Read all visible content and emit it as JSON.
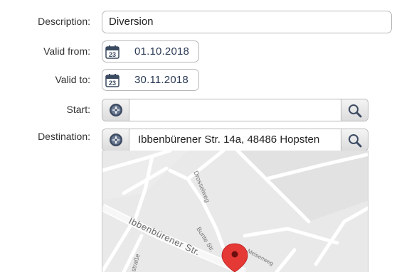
{
  "form": {
    "description": {
      "label": "Description:",
      "value": "Diversion"
    },
    "valid_from": {
      "label": "Valid from:",
      "value": "01.10.2018",
      "calendar_day": "23"
    },
    "valid_to": {
      "label": "Valid to:",
      "value": "30.11.2018",
      "calendar_day": "23"
    },
    "start": {
      "label": "Start:",
      "value": ""
    },
    "destination": {
      "label": "Destination:",
      "value": "Ibbenbürener Str. 14a, 48486 Hopsten"
    }
  },
  "map": {
    "streets": {
      "drosselweg": "Drosselweg",
      "ibbenburener": "Ibbenbürener Str.",
      "bunte": "Bunte Str.",
      "meisenweg": "Meisenweg",
      "strasse_fragment": "straße"
    },
    "marker_color": "#e53935"
  },
  "icons": {
    "calendar": "calendar-icon",
    "locate": "compass-locate-icon",
    "search": "magnifier-search-icon"
  }
}
